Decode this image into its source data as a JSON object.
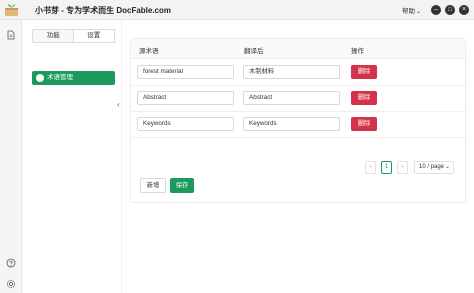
{
  "app": {
    "title": "小书芽 - 专为学术而生 DocFable.com",
    "help_label": "帮助",
    "minimize_glyph": "–",
    "maximize_glyph": "□",
    "close_glyph": "×"
  },
  "rail": {
    "icons": [
      "document-icon",
      "help-icon",
      "settings-icon"
    ]
  },
  "sidepanel": {
    "tabs": [
      {
        "label": "功能"
      },
      {
        "label": "设置"
      }
    ],
    "active_tab": 1,
    "menu": [
      {
        "label": "术语管理"
      }
    ]
  },
  "table": {
    "columns": [
      "源术语",
      "翻译后",
      "操作"
    ],
    "rows": [
      {
        "source": "forest material",
        "translated": "木制材料",
        "action": "删除"
      },
      {
        "source": "Abstract",
        "translated": "Abstract",
        "action": "删除"
      },
      {
        "source": "Keywords",
        "translated": "Keywords",
        "action": "删除"
      }
    ]
  },
  "pagination": {
    "prev": "‹",
    "next": "›",
    "current_page": "1",
    "page_size": "10 / page",
    "page_size_chevron": "⌄"
  },
  "actions": {
    "add_label": "新增",
    "save_label": "保存"
  },
  "colors": {
    "accent": "#1a9a5b",
    "danger": "#d4314a"
  }
}
